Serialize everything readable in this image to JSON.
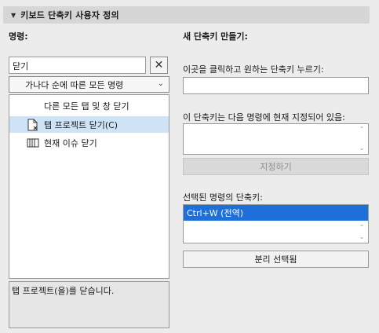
{
  "header": {
    "title": "키보드 단축키 사용자 정의"
  },
  "left": {
    "label": "명령:",
    "search_value": "닫기",
    "clear_symbol": "✕",
    "sort_select": "가나다 순에 따른 모든 명령",
    "items": [
      {
        "label": "다른 모든 탭 및 창 닫기",
        "icon": "none"
      },
      {
        "label": "탭 프로젝트 닫기(C)",
        "icon": "document-close-icon"
      },
      {
        "label": "현재 이슈 닫기",
        "icon": "issue-list-icon"
      }
    ],
    "description": "탭 프로젝트(을)를 닫습니다."
  },
  "right": {
    "label": "새 단축키 만들기:",
    "press_label": "이곳을 클릭하고 원하는 단축키 누르기:",
    "press_value": "",
    "assigned_label": "이 단축키는 다음 명령에 현재 지정되어 있음:",
    "assign_button": "지정하기",
    "selected_label": "선택된 명령의 단축키:",
    "shortcuts": [
      "Ctrl+W (전역)"
    ],
    "remove_button": "분리 선택됨"
  },
  "colors": {
    "selection": "#1e6fd9",
    "row_highlight": "#cfe3f7"
  }
}
